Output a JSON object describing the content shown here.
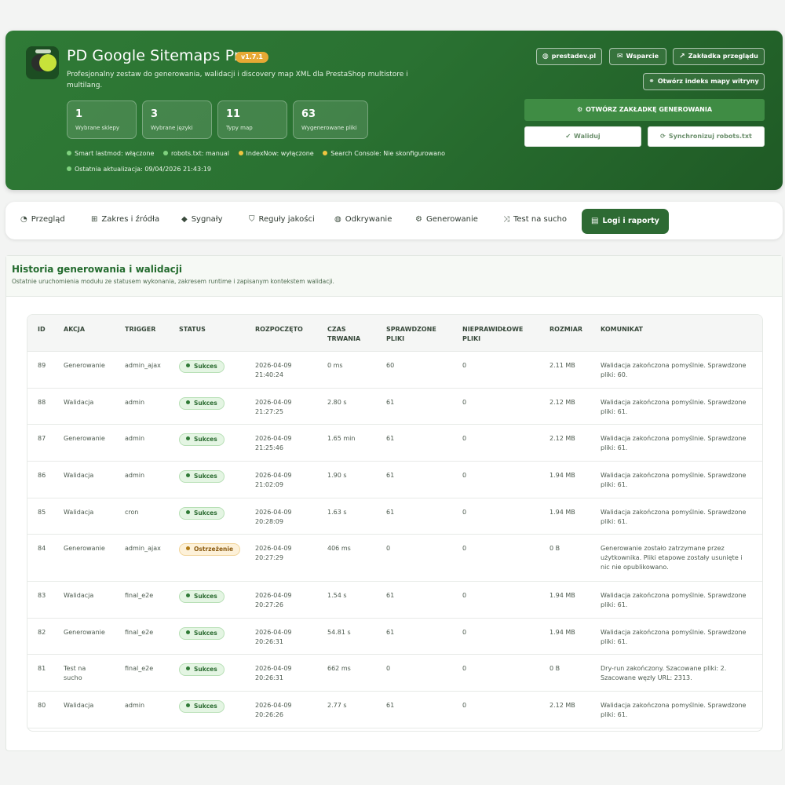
{
  "header": {
    "title": "PD Google Sitemaps Pro",
    "version": "v1.7.1",
    "subtitle": "Profesjonalny zestaw do generowania, walidacji i discovery map XML dla PrestaShop multistore i multilang.",
    "stats": [
      {
        "value": "1",
        "label": "Wybrane sklepy"
      },
      {
        "value": "3",
        "label": "Wybrane języki"
      },
      {
        "value": "11",
        "label": "Typy map"
      },
      {
        "value": "63",
        "label": "Wygenerowane pliki"
      }
    ],
    "status_items": [
      {
        "text": "Smart lastmod: włączone",
        "color": "green"
      },
      {
        "text": "robots.txt: manual",
        "color": "green"
      },
      {
        "text": "IndexNow: wyłączone",
        "color": "yellow"
      },
      {
        "text": "Search Console: Nie skonfigurowano",
        "color": "yellow"
      }
    ],
    "last_update": "Ostatnia aktualizacja: 09/04/2026 21:43:19",
    "buttons": {
      "prestadev": "prestadev.pl",
      "support": "Wsparcie",
      "review_tab": "Zakładka przeglądu",
      "open_index": "Otwórz indeks mapy witryny",
      "open_generation": "OTWÓRZ ZAKŁADKĘ GENEROWANIA",
      "validate": "Waliduj",
      "sync_robots": "Synchronizuj robots.txt"
    }
  },
  "tabs": [
    {
      "label": "Przegląd",
      "icon": "dashboard-icon"
    },
    {
      "label": "Zakres i źródła",
      "icon": "sitemap-icon"
    },
    {
      "label": "Sygnały",
      "icon": "tags-icon"
    },
    {
      "label": "Reguły jakości",
      "icon": "shield-icon"
    },
    {
      "label": "Odkrywanie",
      "icon": "globe-icon"
    },
    {
      "label": "Generowanie",
      "icon": "cogs-icon"
    },
    {
      "label": "Test na sucho",
      "icon": "random-icon"
    },
    {
      "label": "Logi i raporty",
      "icon": "list-icon",
      "active": true
    }
  ],
  "panel": {
    "title": "Historia generowania i walidacji",
    "subtitle": "Ostatnie uruchomienia modułu ze statusem wykonania, zakresem runtime i zapisanym kontekstem walidacji."
  },
  "table": {
    "columns": [
      "ID",
      "AKCJA",
      "TRIGGER",
      "STATUS",
      "ROZPOCZĘTO",
      "CZAS\nTRWANIA",
      "SPRAWDZONE\nPLIKI",
      "NIEPRAWIDŁOWE\nPLIKI",
      "ROZMIAR",
      "KOMUNIKAT"
    ],
    "rows": [
      {
        "id": "89",
        "action": "Generowanie",
        "trigger": "admin_ajax",
        "status": "Sukces",
        "status_type": "ok",
        "started": "2026-04-09\n21:40:24",
        "duration": "0 ms",
        "checked": "60",
        "invalid": "0",
        "size": "2.11 MB",
        "message": "Walidacja zakończona pomyślnie. Sprawdzone pliki: 60."
      },
      {
        "id": "88",
        "action": "Walidacja",
        "trigger": "admin",
        "status": "Sukces",
        "status_type": "ok",
        "started": "2026-04-09\n21:27:25",
        "duration": "2.80 s",
        "checked": "61",
        "invalid": "0",
        "size": "2.12 MB",
        "message": "Walidacja zakończona pomyślnie. Sprawdzone pliki: 61."
      },
      {
        "id": "87",
        "action": "Generowanie",
        "trigger": "admin",
        "status": "Sukces",
        "status_type": "ok",
        "started": "2026-04-09\n21:25:46",
        "duration": "1.65 min",
        "checked": "61",
        "invalid": "0",
        "size": "2.12 MB",
        "message": "Walidacja zakończona pomyślnie. Sprawdzone pliki: 61."
      },
      {
        "id": "86",
        "action": "Walidacja",
        "trigger": "admin",
        "status": "Sukces",
        "status_type": "ok",
        "started": "2026-04-09\n21:02:09",
        "duration": "1.90 s",
        "checked": "61",
        "invalid": "0",
        "size": "1.94 MB",
        "message": "Walidacja zakończona pomyślnie. Sprawdzone pliki: 61."
      },
      {
        "id": "85",
        "action": "Walidacja",
        "trigger": "cron",
        "status": "Sukces",
        "status_type": "ok",
        "started": "2026-04-09\n20:28:09",
        "duration": "1.63 s",
        "checked": "61",
        "invalid": "0",
        "size": "1.94 MB",
        "message": "Walidacja zakończona pomyślnie. Sprawdzone pliki: 61."
      },
      {
        "id": "84",
        "action": "Generowanie",
        "trigger": "admin_ajax",
        "status": "Ostrzeżenie",
        "status_type": "warn",
        "started": "2026-04-09\n20:27:29",
        "duration": "406 ms",
        "checked": "0",
        "invalid": "0",
        "size": "0 B",
        "message": "Generowanie zostało zatrzymane przez użytkownika. Pliki etapowe zostały usunięte i nic nie opublikowano."
      },
      {
        "id": "83",
        "action": "Walidacja",
        "trigger": "final_e2e",
        "status": "Sukces",
        "status_type": "ok",
        "started": "2026-04-09\n20:27:26",
        "duration": "1.54 s",
        "checked": "61",
        "invalid": "0",
        "size": "1.94 MB",
        "message": "Walidacja zakończona pomyślnie. Sprawdzone pliki: 61."
      },
      {
        "id": "82",
        "action": "Generowanie",
        "trigger": "final_e2e",
        "status": "Sukces",
        "status_type": "ok",
        "started": "2026-04-09\n20:26:31",
        "duration": "54.81 s",
        "checked": "61",
        "invalid": "0",
        "size": "1.94 MB",
        "message": "Walidacja zakończona pomyślnie. Sprawdzone pliki: 61."
      },
      {
        "id": "81",
        "action": "Test na\nsucho",
        "trigger": "final_e2e",
        "status": "Sukces",
        "status_type": "ok",
        "started": "2026-04-09\n20:26:31",
        "duration": "662 ms",
        "checked": "0",
        "invalid": "0",
        "size": "0 B",
        "message": "Dry-run zakończony. Szacowane pliki: 2. Szacowane węzły URL: 2313."
      },
      {
        "id": "80",
        "action": "Walidacja",
        "trigger": "admin",
        "status": "Sukces",
        "status_type": "ok",
        "started": "2026-04-09\n20:26:26",
        "duration": "2.77 s",
        "checked": "61",
        "invalid": "0",
        "size": "2.12 MB",
        "message": "Walidacja zakończona pomyślnie. Sprawdzone pliki: 61."
      }
    ]
  }
}
